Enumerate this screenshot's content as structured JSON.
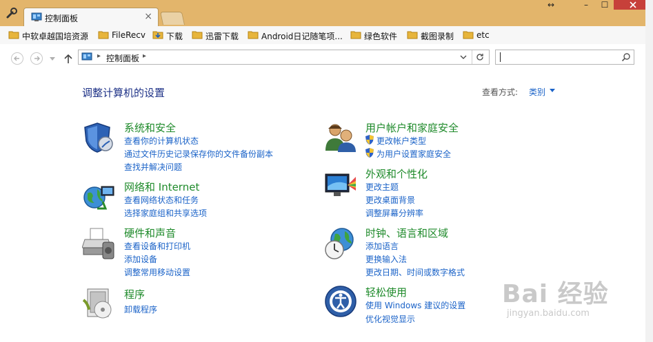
{
  "browser": {
    "active_tab_title": "控制面板",
    "bookmarks": [
      "中软卓越国培资源",
      "FileRecv",
      "下载",
      "迅雷下载",
      "Android日记随笔项...",
      "绿色软件",
      "截图录制",
      "etc"
    ],
    "address_breadcrumb": "控制面板",
    "search_placeholder": ""
  },
  "control_panel": {
    "heading": "调整计算机的设置",
    "view_by_label": "查看方式:",
    "view_by_value": "类别",
    "categories_left": [
      {
        "title": "系统和安全",
        "links": [
          "查看你的计算机状态",
          "通过文件历史记录保存你的文件备份副本",
          "查找并解决问题"
        ]
      },
      {
        "title": "网络和 Internet",
        "links": [
          "查看网络状态和任务",
          "选择家庭组和共享选项"
        ]
      },
      {
        "title": "硬件和声音",
        "links": [
          "查看设备和打印机",
          "添加设备",
          "调整常用移动设置"
        ]
      },
      {
        "title": "程序",
        "links": [
          "卸载程序"
        ]
      }
    ],
    "categories_right": [
      {
        "title": "用户帐户和家庭安全",
        "links": [
          "更改帐户类型",
          "为用户设置家庭安全"
        ]
      },
      {
        "title": "外观和个性化",
        "links": [
          "更改主题",
          "更改桌面背景",
          "调整屏幕分辨率"
        ]
      },
      {
        "title": "时钟、语言和区域",
        "links": [
          "添加语言",
          "更换输入法",
          "更改日期、时间或数字格式"
        ]
      },
      {
        "title": "轻松使用",
        "links": [
          "使用 Windows 建议的设置",
          "优化视觉显示"
        ]
      }
    ]
  },
  "watermark": {
    "main": "Bai 经验",
    "sub": "jingyan.baidu.com"
  },
  "colors": {
    "frame": "#e3b56b",
    "link": "#1b63c8",
    "category": "#1e8a2a",
    "heading": "#1e3287",
    "close": "#c7403a"
  }
}
